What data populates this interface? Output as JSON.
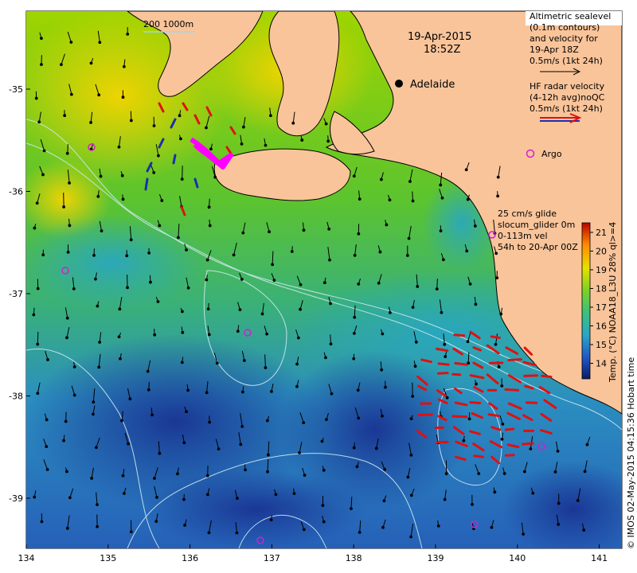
{
  "map": {
    "date": "19-Apr-2015",
    "time": "18:52Z",
    "scale_label": "200  1000m",
    "city": "Adelaide",
    "x_ticks": [
      "134",
      "135",
      "136",
      "137",
      "138",
      "139",
      "140",
      "141"
    ],
    "y_ticks": [
      "-35",
      "-36",
      "-37",
      "-38",
      "-39"
    ],
    "legend": {
      "altimetric_lines": [
        "Altimetric sealevel",
        "(0.1m contours)",
        "and velocity for",
        "19-Apr 18Z",
        "0.5m/s (1kt 24h)"
      ],
      "hf_lines": [
        "HF radar velocity",
        "(4-12h avg)noQC",
        "0.5m/s (1kt 24h)"
      ],
      "argo": "Argo",
      "glider_lines": [
        "25 cm/s glide",
        "slocum_glider 0m",
        "0-113m vel",
        "54h to 20-Apr 00Z"
      ]
    },
    "colorbar": {
      "ticks": [
        "21",
        "20",
        "19",
        "18",
        "17",
        "16",
        "15",
        "14"
      ],
      "label": "Temp. (°C) NOAA18_L3U 28% ql>=4"
    },
    "credit": "© IMOS 02-May-2015 04:15:36 Hobart time",
    "colors": {
      "land": "#f9c49a",
      "warm": "#f4d400",
      "mid": "#5fc42a",
      "cool": "#2ea2b8",
      "deep": "#1c3f9a",
      "hf_arrow": "#e01010",
      "argo": "#d020d0",
      "glider": "#ff00ff"
    }
  }
}
